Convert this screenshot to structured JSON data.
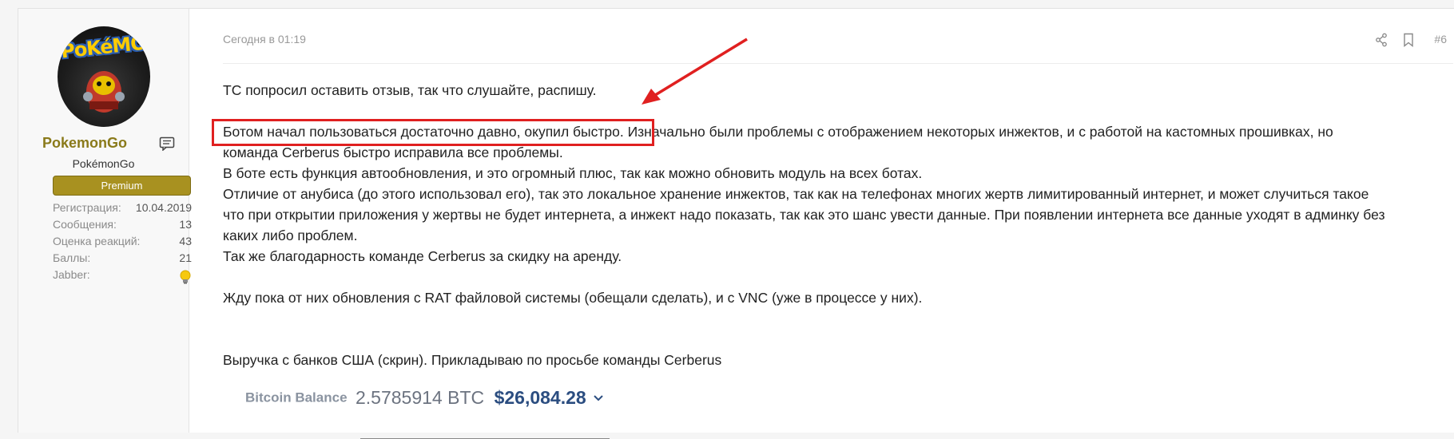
{
  "user": {
    "avatar_text": "PoKéMON",
    "username": "PokemonGo",
    "title": "PokémonGo",
    "badge": "Premium",
    "stats": [
      {
        "label": "Регистрация:",
        "value": "10.04.2019"
      },
      {
        "label": "Сообщения:",
        "value": "13"
      },
      {
        "label": "Оценка реакций:",
        "value": "43"
      },
      {
        "label": "Баллы:",
        "value": "21"
      },
      {
        "label": "Jabber:",
        "value": ""
      }
    ]
  },
  "post": {
    "time": "Сегодня в 01:19",
    "number": "#6",
    "paragraphs": {
      "p1": "ТС попросил оставить отзыв, так что слушайте, распишу.",
      "p2": "Ботом начал пользоваться достаточно давно, окупил быстро. Изначально были проблемы с отображением некоторых инжектов, и с работой на кастомных прошивках, но",
      "p3": "команда Cerberus быстро исправила все проблемы.",
      "p4": "В боте есть функция автообновления, и это огромный плюс, так как можно обновить модуль на всех ботах.",
      "p5": "Отличие от анубиса (до этого использовал его), так это локальное хранение инжектов, так как на телефонах многих жертв лимитированный интернет, и может случиться такое",
      "p6": "что при открытии приложения у жертвы не будет интернета, а инжект надо показать, так как это шанс увести данные. При появлении интернета все данные уходят в админку без",
      "p7": "каких либо проблем.",
      "p8": "Так же благодарность команде Cerberus за скидку на аренду.",
      "p9": "Жду пока от них обновления с RAT файловой системы (обещали сделать), и с VNC (уже в процессе у них).",
      "p10": "Выручка с банков США (скрин). Прикладываю по просьбе команды Cerberus"
    },
    "btc": {
      "label": "Bitcoin Balance",
      "amount": "2.5785914 BTC",
      "usd": "$26,084.28"
    }
  },
  "colors": {
    "accent_username": "#8a7a1a",
    "badge_bg": "#a89120",
    "annotation_red": "#e02020",
    "btc_usd": "#2b4d80"
  }
}
